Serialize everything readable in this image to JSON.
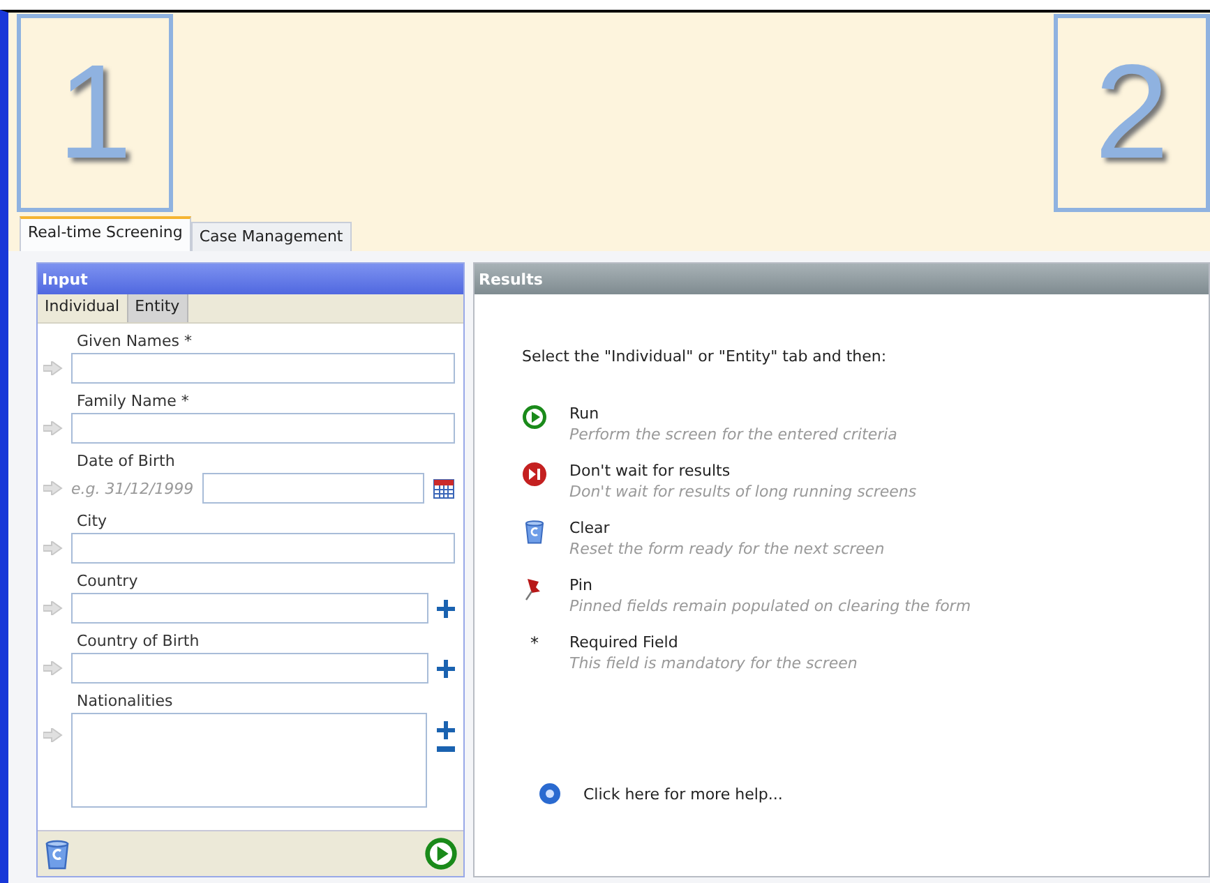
{
  "callouts": [
    "1",
    "2"
  ],
  "main_tabs": [
    {
      "label": "Real-time Screening",
      "selected": true
    },
    {
      "label": "Case Management",
      "selected": false
    }
  ],
  "input": {
    "title": "Input",
    "tabs": [
      {
        "label": "Individual",
        "selected": true
      },
      {
        "label": "Entity",
        "selected": false
      }
    ],
    "fields": [
      {
        "kind": "text",
        "label": "Given Names *"
      },
      {
        "kind": "text",
        "label": "Family Name *"
      },
      {
        "kind": "date",
        "label": "Date of Birth",
        "hint": "e.g. 31/12/1999"
      },
      {
        "kind": "text",
        "label": "City"
      },
      {
        "kind": "add",
        "label": "Country"
      },
      {
        "kind": "add",
        "label": "Country of Birth"
      },
      {
        "kind": "list",
        "label": "Nationalities"
      }
    ]
  },
  "results": {
    "title": "Results",
    "intro": "Select the \"Individual\" or \"Entity\" tab and then:",
    "items": [
      {
        "kind": "run",
        "title": "Run",
        "desc": "Perform the screen for the entered criteria"
      },
      {
        "kind": "skip",
        "title": "Don't wait for results",
        "desc": "Don't wait for results of long running screens"
      },
      {
        "kind": "clear",
        "title": "Clear",
        "desc": "Reset the form ready for the next screen"
      },
      {
        "kind": "pin",
        "title": "Pin",
        "desc": "Pinned fields remain populated on clearing the form"
      },
      {
        "kind": "required",
        "marker": "*",
        "title": "Required Field",
        "desc": "This field is mandatory for the screen"
      }
    ],
    "help": "Click here for more help..."
  }
}
